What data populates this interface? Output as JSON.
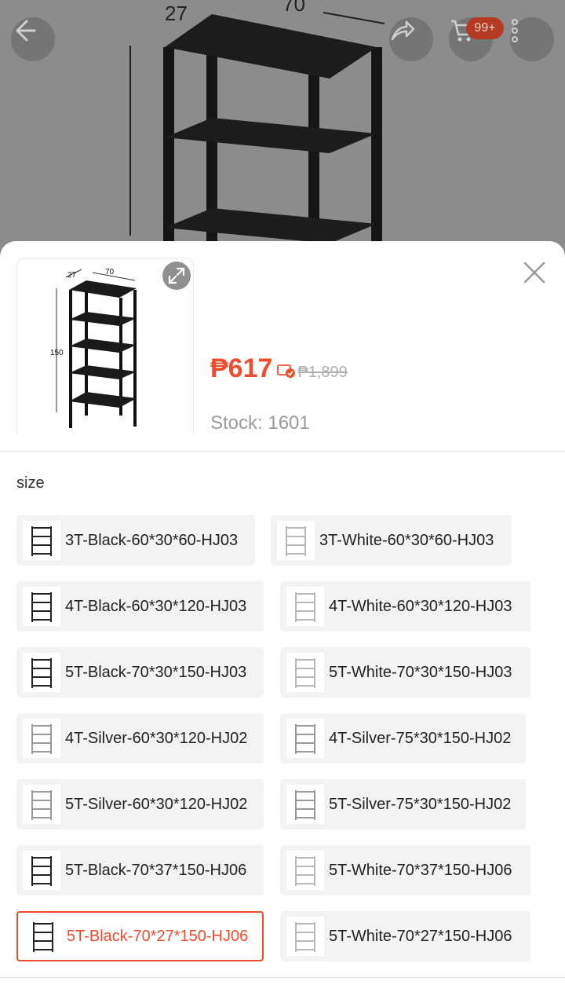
{
  "header": {
    "cart_badge": "99+",
    "bg_dimensions": [
      "27",
      "70"
    ]
  },
  "product": {
    "thumb_dimensions": {
      "depth": "27",
      "width": "70",
      "height": "150"
    },
    "price": "₱617",
    "original_price": "₱1,899",
    "stock": "Stock: 1601"
  },
  "variation": {
    "label": "size",
    "options": [
      {
        "label": "3T-Black-60*30*60-HJ03",
        "selected": false
      },
      {
        "label": "3T-White-60*30*60-HJ03",
        "selected": false
      },
      {
        "label": "4T-Black-60*30*120-HJ03",
        "selected": false
      },
      {
        "label": "4T-White-60*30*120-HJ03",
        "selected": false
      },
      {
        "label": "5T-Black-70*30*150-HJ03",
        "selected": false
      },
      {
        "label": "5T-White-70*30*150-HJ03",
        "selected": false
      },
      {
        "label": "4T-Silver-60*30*120-HJ02",
        "selected": false
      },
      {
        "label": "4T-Silver-75*30*150-HJ02",
        "selected": false
      },
      {
        "label": "5T-Silver-60*30*120-HJ02",
        "selected": false
      },
      {
        "label": "5T-Silver-75*30*150-HJ02",
        "selected": false
      },
      {
        "label": "5T-Black-70*37*150-HJ06",
        "selected": false
      },
      {
        "label": "5T-White-70*37*150-HJ06",
        "selected": false
      },
      {
        "label": "5T-Black-70*27*150-HJ06",
        "selected": true
      },
      {
        "label": "5T-White-70*27*150-HJ06",
        "selected": false
      }
    ]
  },
  "colors": {
    "accent": "#ee4d2d",
    "badge": "#b43a24"
  },
  "icons": [
    "back-arrow-icon",
    "share-icon",
    "cart-icon",
    "more-icon",
    "expand-icon",
    "close-icon",
    "coin-icon"
  ]
}
